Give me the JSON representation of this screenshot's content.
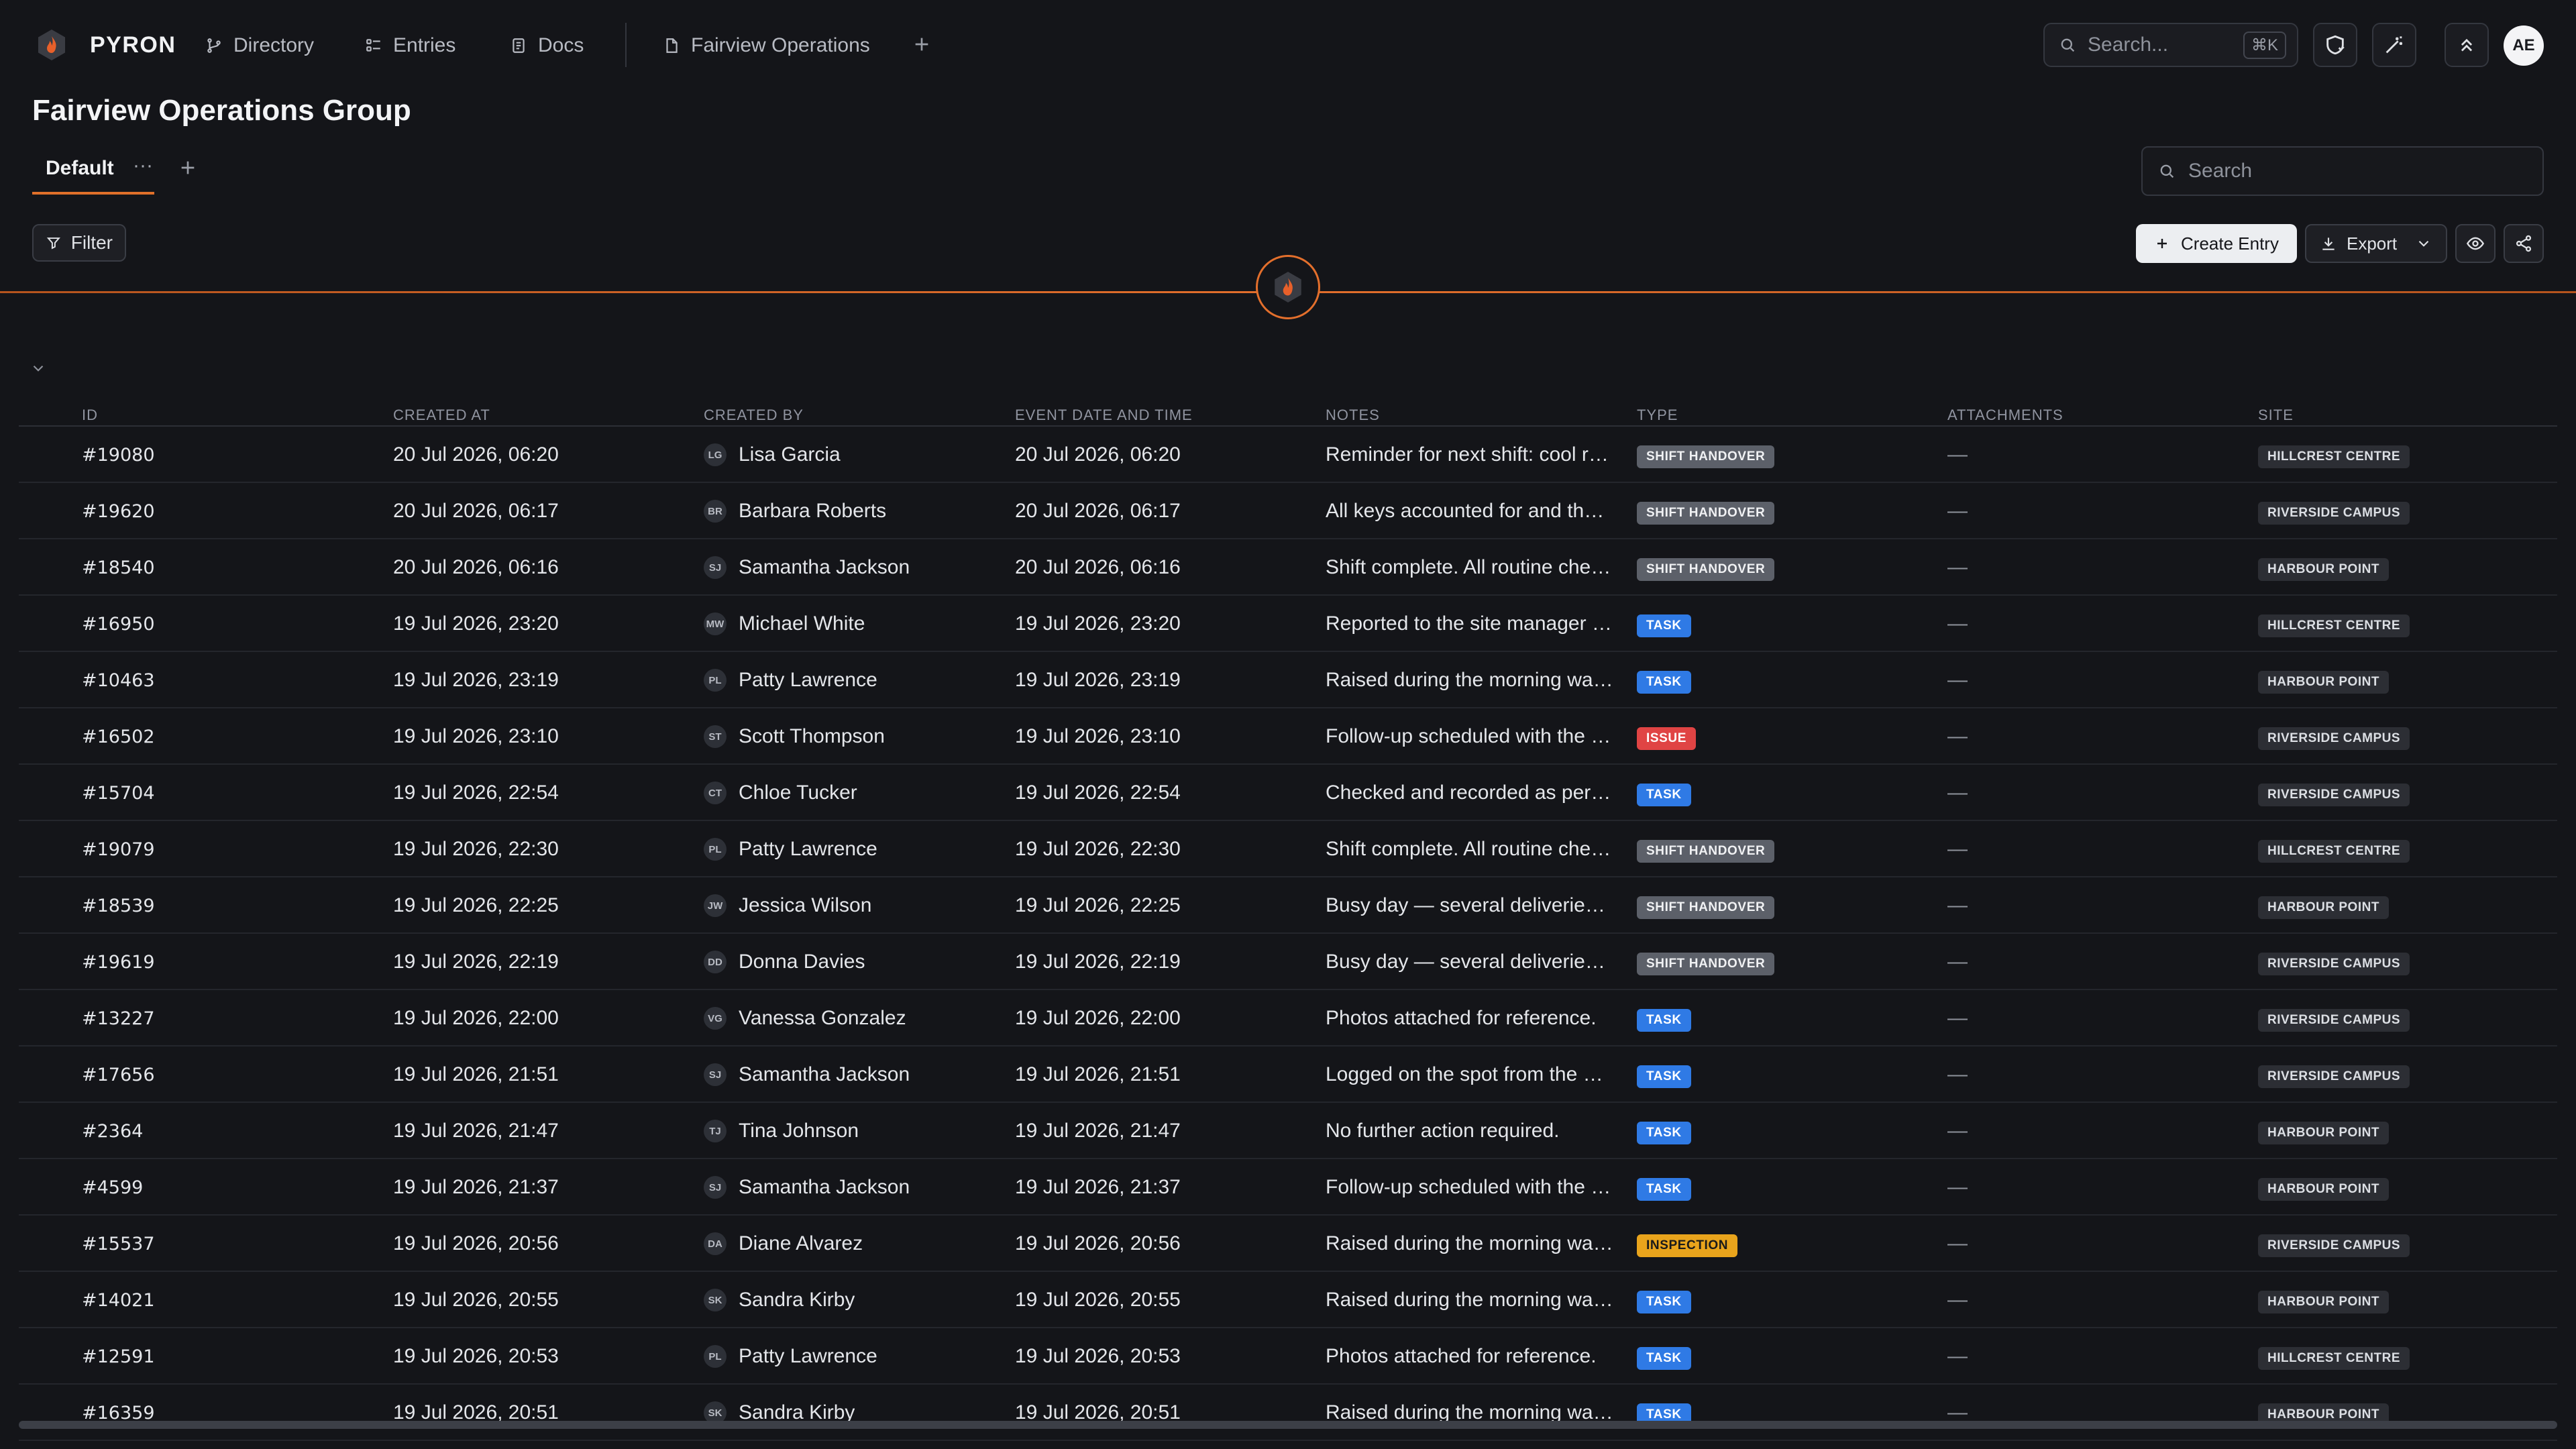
{
  "nav": {
    "brand": "PYRON",
    "items": [
      {
        "label": "Directory",
        "icon": "directory-icon"
      },
      {
        "label": "Entries",
        "icon": "entries-icon"
      },
      {
        "label": "Docs",
        "icon": "docs-icon"
      },
      {
        "label": "Fairview Operations",
        "icon": "page-icon"
      }
    ],
    "search_placeholder": "Search...",
    "search_shortcut": "⌘K",
    "user_initials": "AE"
  },
  "page": {
    "title": "Fairview Operations Group",
    "view_tab": "Default",
    "view_tab_menu": "···",
    "search_placeholder": "Search"
  },
  "toolbar": {
    "filter_label": "Filter",
    "create_label": "Create Entry",
    "export_label": "Export"
  },
  "table": {
    "columns": [
      "ID",
      "CREATED AT",
      "CREATED BY",
      "EVENT DATE AND TIME",
      "NOTES",
      "TYPE",
      "ATTACHMENTS",
      "SITE"
    ],
    "rows": [
      {
        "id": "#19080",
        "created_at": "20 Jul 2026, 06:20",
        "initials": "LG",
        "created_by": "Lisa Garcia",
        "event": "20 Jul 2026, 06:20",
        "notes": "Reminder for next shift: cool room temperature check",
        "type": "SHIFT HANDOVER",
        "attachments": "—",
        "site": "HILLCREST CENTRE"
      },
      {
        "id": "#19620",
        "created_at": "20 Jul 2026, 06:17",
        "initials": "BR",
        "created_by": "Barbara Roberts",
        "event": "20 Jul 2026, 06:17",
        "notes": "All keys accounted for and the site secured",
        "type": "SHIFT HANDOVER",
        "attachments": "—",
        "site": "RIVERSIDE CAMPUS"
      },
      {
        "id": "#18540",
        "created_at": "20 Jul 2026, 06:16",
        "initials": "SJ",
        "created_by": "Samantha Jackson",
        "event": "20 Jul 2026, 06:16",
        "notes": "Shift complete. All routine checks done",
        "type": "SHIFT HANDOVER",
        "attachments": "—",
        "site": "HARBOUR POINT"
      },
      {
        "id": "#16950",
        "created_at": "19 Jul 2026, 23:20",
        "initials": "MW",
        "created_by": "Michael White",
        "event": "19 Jul 2026, 23:20",
        "notes": "Reported to the site manager and logged",
        "type": "TASK",
        "attachments": "—",
        "site": "HILLCREST CENTRE"
      },
      {
        "id": "#10463",
        "created_at": "19 Jul 2026, 23:19",
        "initials": "PL",
        "created_by": "Patty Lawrence",
        "event": "19 Jul 2026, 23:19",
        "notes": "Raised during the morning walkthrough",
        "type": "TASK",
        "attachments": "—",
        "site": "HARBOUR POINT"
      },
      {
        "id": "#16502",
        "created_at": "19 Jul 2026, 23:10",
        "initials": "ST",
        "created_by": "Scott Thompson",
        "event": "19 Jul 2026, 23:10",
        "notes": "Follow-up scheduled with the facilities team",
        "type": "ISSUE",
        "attachments": "—",
        "site": "RIVERSIDE CAMPUS"
      },
      {
        "id": "#15704",
        "created_at": "19 Jul 2026, 22:54",
        "initials": "CT",
        "created_by": "Chloe Tucker",
        "event": "19 Jul 2026, 22:54",
        "notes": "Checked and recorded as per site procedure",
        "type": "TASK",
        "attachments": "—",
        "site": "RIVERSIDE CAMPUS"
      },
      {
        "id": "#19079",
        "created_at": "19 Jul 2026, 22:30",
        "initials": "PL",
        "created_by": "Patty Lawrence",
        "event": "19 Jul 2026, 22:30",
        "notes": "Shift complete. All routine checks done",
        "type": "SHIFT HANDOVER",
        "attachments": "—",
        "site": "HILLCREST CENTRE"
      },
      {
        "id": "#18539",
        "created_at": "19 Jul 2026, 22:25",
        "initials": "JW",
        "created_by": "Jessica Wilson",
        "event": "19 Jul 2026, 22:25",
        "notes": "Busy day — several deliveries and visitors",
        "type": "SHIFT HANDOVER",
        "attachments": "—",
        "site": "HARBOUR POINT"
      },
      {
        "id": "#19619",
        "created_at": "19 Jul 2026, 22:19",
        "initials": "DD",
        "created_by": "Donna Davies",
        "event": "19 Jul 2026, 22:19",
        "notes": "Busy day — several deliveries and visitors",
        "type": "SHIFT HANDOVER",
        "attachments": "—",
        "site": "RIVERSIDE CAMPUS"
      },
      {
        "id": "#13227",
        "created_at": "19 Jul 2026, 22:00",
        "initials": "VG",
        "created_by": "Vanessa Gonzalez",
        "event": "19 Jul 2026, 22:00",
        "notes": "Photos attached for reference.",
        "type": "TASK",
        "attachments": "—",
        "site": "RIVERSIDE CAMPUS"
      },
      {
        "id": "#17656",
        "created_at": "19 Jul 2026, 21:51",
        "initials": "SJ",
        "created_by": "Samantha Jackson",
        "event": "19 Jul 2026, 21:51",
        "notes": "Logged on the spot from the mobile app",
        "type": "TASK",
        "attachments": "—",
        "site": "RIVERSIDE CAMPUS"
      },
      {
        "id": "#2364",
        "created_at": "19 Jul 2026, 21:47",
        "initials": "TJ",
        "created_by": "Tina Johnson",
        "event": "19 Jul 2026, 21:47",
        "notes": "No further action required.",
        "type": "TASK",
        "attachments": "—",
        "site": "HARBOUR POINT"
      },
      {
        "id": "#4599",
        "created_at": "19 Jul 2026, 21:37",
        "initials": "SJ",
        "created_by": "Samantha Jackson",
        "event": "19 Jul 2026, 21:37",
        "notes": "Follow-up scheduled with the facilities team",
        "type": "TASK",
        "attachments": "—",
        "site": "HARBOUR POINT"
      },
      {
        "id": "#15537",
        "created_at": "19 Jul 2026, 20:56",
        "initials": "DA",
        "created_by": "Diane Alvarez",
        "event": "19 Jul 2026, 20:56",
        "notes": "Raised during the morning walkthrough",
        "type": "INSPECTION",
        "attachments": "—",
        "site": "RIVERSIDE CAMPUS"
      },
      {
        "id": "#14021",
        "created_at": "19 Jul 2026, 20:55",
        "initials": "SK",
        "created_by": "Sandra Kirby",
        "event": "19 Jul 2026, 20:55",
        "notes": "Raised during the morning walkthrough",
        "type": "TASK",
        "attachments": "—",
        "site": "HARBOUR POINT"
      },
      {
        "id": "#12591",
        "created_at": "19 Jul 2026, 20:53",
        "initials": "PL",
        "created_by": "Patty Lawrence",
        "event": "19 Jul 2026, 20:53",
        "notes": "Photos attached for reference.",
        "type": "TASK",
        "attachments": "—",
        "site": "HILLCREST CENTRE"
      },
      {
        "id": "#16359",
        "created_at": "19 Jul 2026, 20:51",
        "initials": "SK",
        "created_by": "Sandra Kirby",
        "event": "19 Jul 2026, 20:51",
        "notes": "Raised during the morning walkthrough",
        "type": "TASK",
        "attachments": "—",
        "site": "HARBOUR POINT"
      }
    ]
  },
  "colors": {
    "background": "#141519",
    "accent": "#e36f2c",
    "badge_shift_handover": "#5c6069",
    "badge_task": "#2f7ae5",
    "badge_issue": "#e04444",
    "badge_inspection": "#e9a41c"
  }
}
